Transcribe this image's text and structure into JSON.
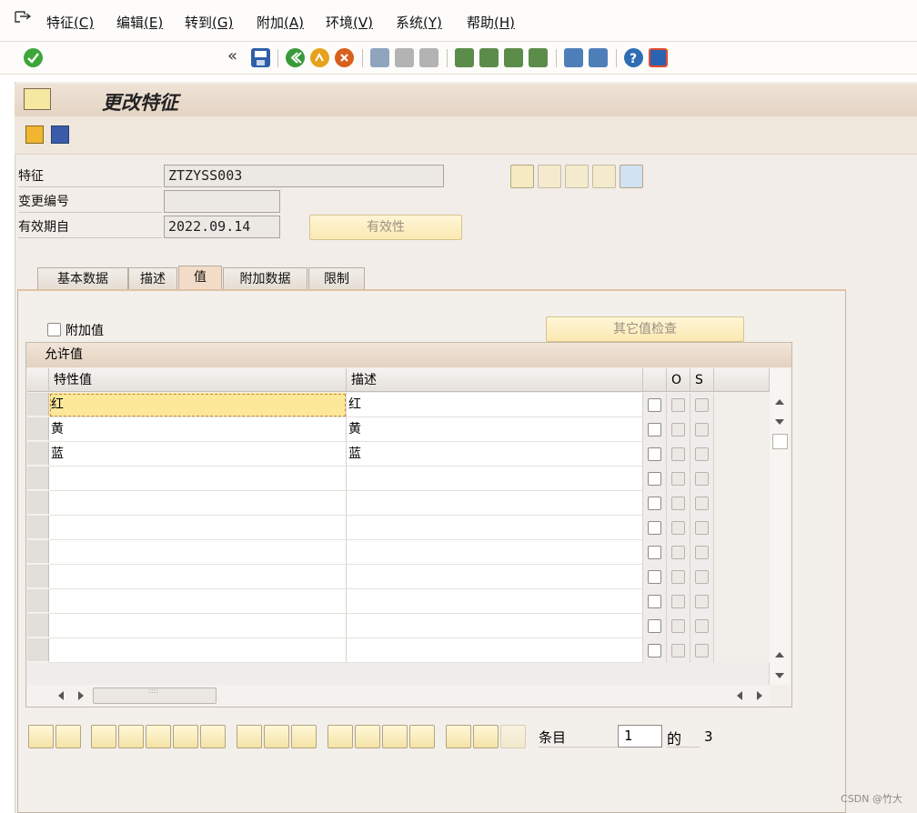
{
  "menu": {
    "items": [
      {
        "label": "特征",
        "key": "(C)"
      },
      {
        "label": "编辑",
        "key": "(E)"
      },
      {
        "label": "转到",
        "key": "(G)"
      },
      {
        "label": "附加",
        "key": "(A)"
      },
      {
        "label": "环境",
        "key": "(V)"
      },
      {
        "label": "系统",
        "key": "(Y)"
      },
      {
        "label": "帮助",
        "key": "(H)"
      }
    ]
  },
  "toolbar": {
    "command_value": "",
    "collapse_glyph": "«"
  },
  "screen": {
    "title": "更改特征"
  },
  "header_fields": {
    "characteristic_label": "特征",
    "characteristic_value": "ZTZYSS003",
    "change_number_label": "变更编号",
    "change_number_value": "",
    "valid_from_label": "有效期自",
    "valid_from_value": "2022.09.14",
    "validity_button": "有效性"
  },
  "tabs": [
    {
      "label": "基本数据",
      "active": false
    },
    {
      "label": "描述",
      "active": false
    },
    {
      "label": "值",
      "active": true
    },
    {
      "label": "附加数据",
      "active": false
    },
    {
      "label": "限制",
      "active": false
    }
  ],
  "values_tab": {
    "additional_values_label": "附加值",
    "other_value_check_button": "其它值检查",
    "table_title": "允许值",
    "columns": [
      "特性值",
      "描述",
      "",
      "O",
      "S"
    ],
    "rows": [
      {
        "value": "红",
        "description": "红"
      },
      {
        "value": "黄",
        "description": "黄"
      },
      {
        "value": "蓝",
        "description": "蓝"
      },
      {
        "value": "",
        "description": ""
      },
      {
        "value": "",
        "description": ""
      },
      {
        "value": "",
        "description": ""
      },
      {
        "value": "",
        "description": ""
      },
      {
        "value": "",
        "description": ""
      },
      {
        "value": "",
        "description": ""
      },
      {
        "value": "",
        "description": ""
      },
      {
        "value": "",
        "description": ""
      },
      {
        "value": "",
        "description": ""
      }
    ],
    "scroll_thumb_glyph": "::::"
  },
  "footer": {
    "entry_label": "条目",
    "entry_value": "1",
    "of_label": "的",
    "total": "3"
  },
  "watermark": "CSDN @竹大",
  "colors": {
    "accent_title_bar": "#e4d4c3",
    "selected_cell": "#fde89a",
    "tab_active": "#f2dcc8"
  }
}
